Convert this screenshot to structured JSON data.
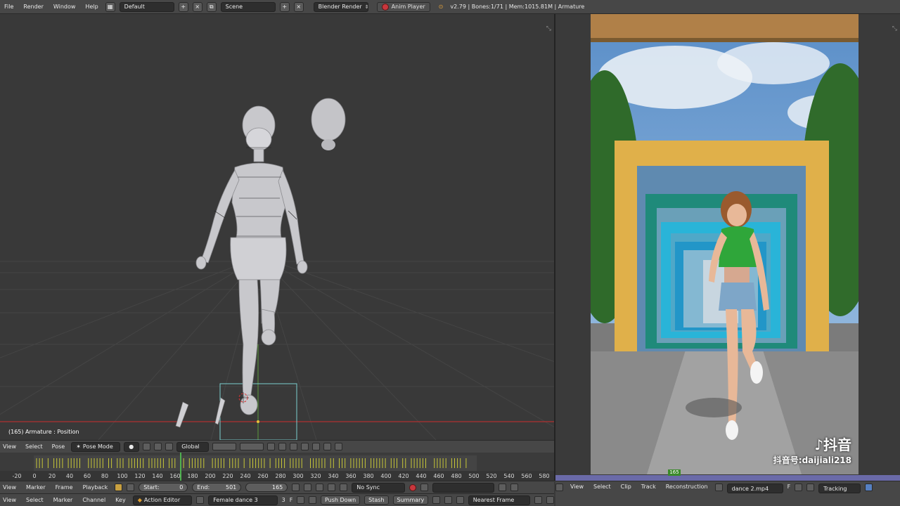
{
  "topbar": {
    "menus": [
      "File",
      "Render",
      "Window",
      "Help"
    ],
    "layout": "Default",
    "scene": "Scene",
    "engine": "Blender Render",
    "anim_player": "Anim Player",
    "info": "v2.79 | Bones:1/71 | Mem:1015.81M | Armature"
  },
  "viewport": {
    "status": "(165) Armature : Position"
  },
  "view3d_header": {
    "menus": [
      "View",
      "Select",
      "Pose"
    ],
    "mode": "Pose Mode",
    "orientation": "Global"
  },
  "timeline": {
    "ticks": [
      "-20",
      "0",
      "20",
      "40",
      "60",
      "80",
      "100",
      "120",
      "140",
      "160",
      "180",
      "200",
      "220",
      "240",
      "260",
      "280",
      "300",
      "320",
      "340",
      "360",
      "380",
      "400",
      "420",
      "440",
      "460",
      "480",
      "500",
      "520",
      "540",
      "560",
      "580"
    ],
    "current_frame_fraction": 0.33
  },
  "timeline_header": {
    "menus": [
      "View",
      "Marker",
      "Frame",
      "Playback"
    ],
    "start_label": "Start:",
    "start_value": "0",
    "end_label": "End:",
    "end_value": "501",
    "current": "165",
    "sync": "No Sync"
  },
  "action_header": {
    "menus": [
      "View",
      "Select",
      "Marker",
      "Channel",
      "Key"
    ],
    "editor": "Action Editor",
    "action_name": "Female dance 3",
    "users": "3",
    "fake_user": "F",
    "push_down": "Push Down",
    "stash": "Stash",
    "summary": "Summary",
    "snap": "Nearest Frame"
  },
  "clip_header": {
    "menus": [
      "View",
      "Select",
      "Clip",
      "Track",
      "Reconstruction"
    ],
    "clip_name": "dance 2.mp4",
    "fake_user": "F",
    "mode": "Tracking"
  },
  "clip": {
    "frame_marker": "165",
    "watermark_logo": "♪抖音",
    "watermark_id": "抖音号:daijiali218"
  }
}
